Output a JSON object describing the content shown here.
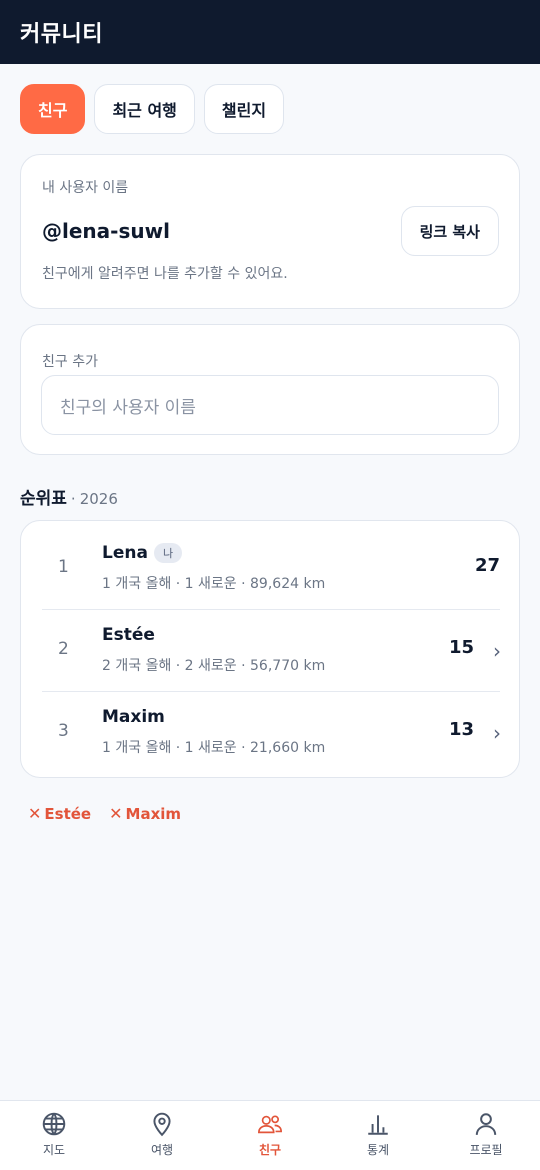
{
  "header": {
    "title": "커뮤니티"
  },
  "tabs": [
    {
      "label": "친구",
      "active": true
    },
    {
      "label": "최근 여행",
      "active": false
    },
    {
      "label": "챌린지",
      "active": false
    }
  ],
  "username_card": {
    "label": "내 사용자 이름",
    "username": "@lena-suwl",
    "copy_button": "링크 복사",
    "hint": "친구에게 알려주면 나를 추가할 수 있어요."
  },
  "add_friend": {
    "label": "친구 추가",
    "placeholder": "친구의 사용자 이름"
  },
  "leaderboard": {
    "title": "순위표",
    "separator": "·",
    "year": "2026",
    "rows": [
      {
        "rank": "1",
        "name": "Lena",
        "badge": "나",
        "stats": "1 개국 올해 · 1 새로운 · 89,624 km",
        "score": "27"
      },
      {
        "rank": "2",
        "name": "Estée",
        "stats": "2 개국 올해 · 2 새로운 · 56,770 km",
        "score": "15"
      },
      {
        "rank": "3",
        "name": "Maxim",
        "stats": "1 개국 올해 · 1 새로운 · 21,660 km",
        "score": "13"
      }
    ]
  },
  "remove_chips": [
    {
      "icon": "x-icon",
      "label": "Estée"
    },
    {
      "icon": "x-icon",
      "label": "Maxim"
    }
  ],
  "bottom_nav": [
    {
      "label": "지도",
      "icon": "globe-icon",
      "active": false
    },
    {
      "label": "여행",
      "icon": "map-pin-icon",
      "active": false
    },
    {
      "label": "친구",
      "icon": "users-icon",
      "active": true
    },
    {
      "label": "통계",
      "icon": "bar-chart-icon",
      "active": false
    },
    {
      "label": "프로필",
      "icon": "user-icon",
      "active": false
    }
  ],
  "colors": {
    "accent": "#ff6a45",
    "accent_text": "#e2553a",
    "header_bg": "#0f1a2e",
    "page_bg": "#f7f9fc"
  }
}
